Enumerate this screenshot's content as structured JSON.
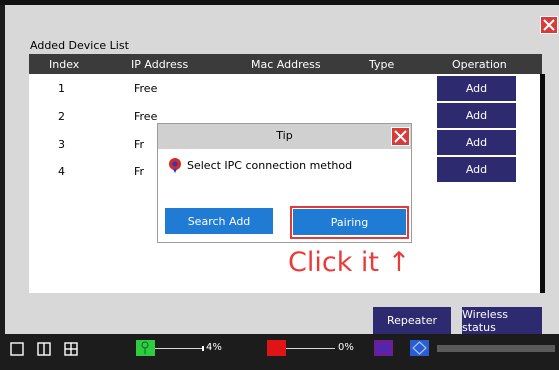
{
  "window": {
    "list_title": "Added Device List",
    "columns": [
      "Index",
      "IP Address",
      "Mac Address",
      "Type",
      "Operation"
    ],
    "rows": [
      {
        "index": "1",
        "ip": "Free",
        "op": "Add"
      },
      {
        "index": "2",
        "ip": "Free",
        "op": "Add"
      },
      {
        "index": "3",
        "ip": "Fr",
        "op": "Add"
      },
      {
        "index": "4",
        "ip": "Fr",
        "op": "Add"
      }
    ],
    "repeater_label": "Repeater",
    "wireless_label": "Wireless status"
  },
  "dialog": {
    "title": "Tip",
    "message": "Select IPC connection method",
    "search_add_label": "Search Add",
    "pairing_label": "Pairing"
  },
  "annotation": {
    "text": "Click it ↑",
    "color": "#ea3b3b"
  },
  "taskbar": {
    "green_percent": "4%",
    "red_percent": "0%",
    "green_progress": 0.04,
    "red_progress": 0.0,
    "icons": [
      "single-view-icon",
      "two-split-view-icon",
      "quad-view-icon"
    ]
  },
  "colors": {
    "accent_blue": "#1f7bd4",
    "button_navy": "#2d2a70",
    "close_red": "#d93b3b"
  }
}
